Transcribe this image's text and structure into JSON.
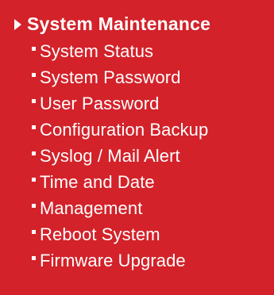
{
  "menu": {
    "header": {
      "label": "System Maintenance",
      "icon": "caret-right-icon"
    },
    "items": [
      {
        "label": "System Status"
      },
      {
        "label": "System Password"
      },
      {
        "label": "User Password"
      },
      {
        "label": "Configuration Backup"
      },
      {
        "label": "Syslog / Mail Alert"
      },
      {
        "label": "Time and Date"
      },
      {
        "label": "Management"
      },
      {
        "label": "Reboot System"
      },
      {
        "label": "Firmware Upgrade"
      }
    ],
    "bullet_icon": "square-bullet-icon",
    "colors": {
      "background": "#d3222a",
      "text": "#ffffff"
    }
  }
}
